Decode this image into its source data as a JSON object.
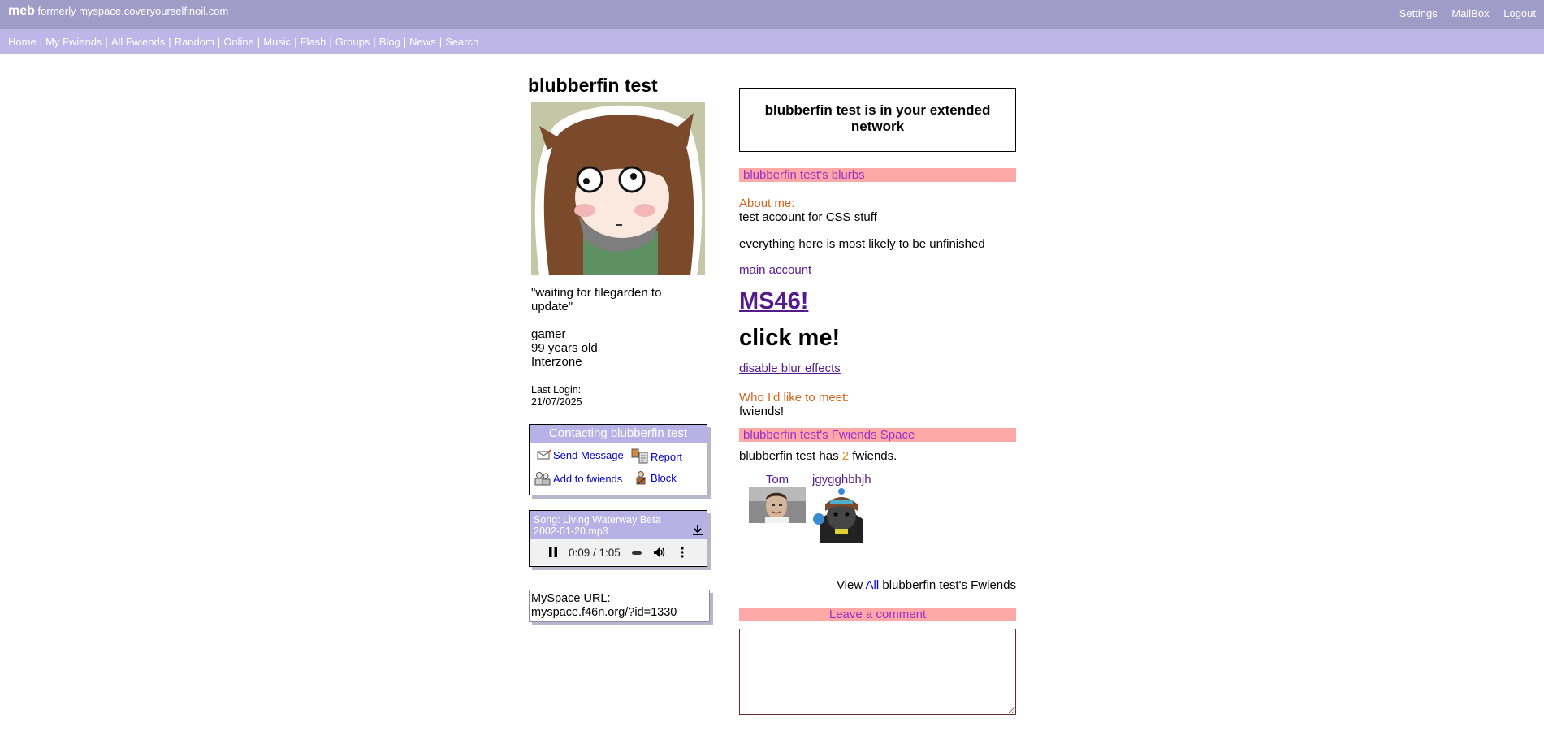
{
  "topbar": {
    "brand": "meb",
    "brand_sub": "formerly myspace.coveryourselfinoil.com",
    "links": [
      "Settings",
      "MailBox",
      "Logout"
    ]
  },
  "nav": [
    "Home",
    "My Fwiends",
    "All Fwiends",
    "Random",
    "Online",
    "Music",
    "Flash",
    "Groups",
    "Blog",
    "News",
    "Search"
  ],
  "profile": {
    "name": "blubberfin test",
    "status": "\"waiting for filegarden to update\"",
    "mood": "gamer",
    "age": "99 years old",
    "location": "Interzone",
    "last_login_label": "Last Login:",
    "last_login": "21/07/2025"
  },
  "contact": {
    "title": "Contacting blubberfin test",
    "send": "Send Message",
    "report": "Report",
    "add": "Add to fwiends",
    "block": "Block"
  },
  "player": {
    "song": "Song: Living Waterway Beta 2002-01-20.mp3",
    "time": "0:09 / 1:05",
    "progress": 0.14
  },
  "url": {
    "label": "MySpace URL:",
    "value": "myspace.f46n.org/?id=1330"
  },
  "network": "blubberfin test is in your extended network",
  "blurbs": {
    "title": "blubberfin test's blurbs",
    "about_label": "About me:",
    "about_text": "test account for CSS stuff",
    "line2": "everything here is most likely to be unfinished",
    "main_account": "main account",
    "ms46": "MS46!",
    "click": "click me!",
    "blur": "disable blur effects",
    "meet_label": "Who I'd like to meet:",
    "meet_text": "fwiends!"
  },
  "fwiends": {
    "title": "blubberfin test's Fwiends Space",
    "count_pre": "blubberfin test has",
    "count": "2",
    "count_post": "fwiends.",
    "list": [
      {
        "name": "Tom"
      },
      {
        "name": "jgygghbhjh"
      }
    ],
    "view_pre": "View",
    "view_link": "All",
    "view_post": "blubberfin test's Fwiends"
  },
  "comment": {
    "title": "Leave a comment"
  }
}
